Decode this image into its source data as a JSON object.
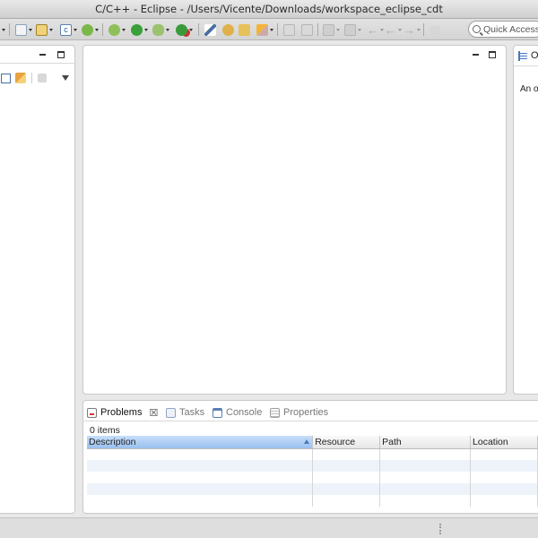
{
  "window": {
    "title": "C/C++ - Eclipse - /Users/Vicente/Downloads/workspace_eclipse_cdt"
  },
  "toolbar": {
    "icons": [
      "new-icon",
      "save-icon",
      "new-class-icon",
      "new-source-icon",
      "build-icon",
      "debug-icon",
      "run-icon",
      "external-tools-icon",
      "search-icon",
      "open-type-icon",
      "open-folder-icon",
      "pencil-icon",
      "prev-annotation-icon",
      "next-annotation-icon",
      "back-icon",
      "forward-icon",
      "pin-icon"
    ],
    "quick_access_placeholder": "Quick Access"
  },
  "outline": {
    "tab_label": "O",
    "message": "An o"
  },
  "bottom": {
    "tabs": [
      {
        "label": "Problems",
        "active": true
      },
      {
        "label": "Tasks",
        "active": false
      },
      {
        "label": "Console",
        "active": false
      },
      {
        "label": "Properties",
        "active": false
      }
    ],
    "item_count": "0 items",
    "columns": [
      "Description",
      "Resource",
      "Path",
      "Location"
    ]
  },
  "colors": {
    "window_bg": "#e8e8e8",
    "panel_bg": "#ffffff",
    "selected_header": "#a9cbf3",
    "stripe": "#eef3fa"
  }
}
